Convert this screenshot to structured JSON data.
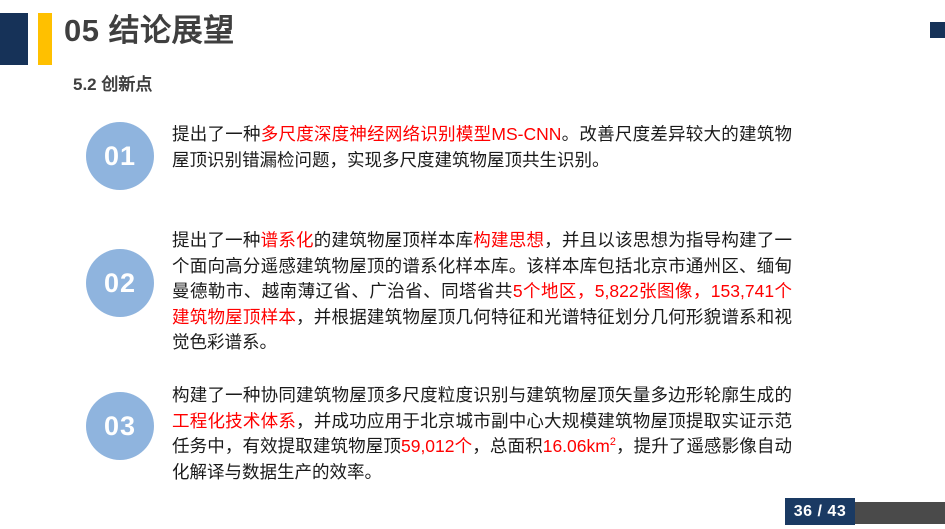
{
  "slide": {
    "title": "05 结论展望",
    "subtitle": "5.2 创新点",
    "accent_navy": "#163258",
    "accent_yellow": "#FFC000",
    "badge_blue": "#8FB4DE",
    "highlight_red": "#FF0000"
  },
  "bullets": [
    {
      "number": "01",
      "segments": [
        {
          "text": "提出了一种",
          "highlight": false
        },
        {
          "text": "多尺度深度神经网络识别模型MS-CNN",
          "highlight": true
        },
        {
          "text": "。改善尺度差异较大的建筑物屋顶识别错漏检问题，实现多尺度建筑物屋顶共生识别。",
          "highlight": false
        }
      ]
    },
    {
      "number": "02",
      "segments": [
        {
          "text": "提出了一种",
          "highlight": false
        },
        {
          "text": "谱系化",
          "highlight": true
        },
        {
          "text": "的建筑物屋顶样本库",
          "highlight": false
        },
        {
          "text": "构建思想",
          "highlight": true
        },
        {
          "text": "，并且以该思想为指导构建了一个面向高分遥感建筑物屋顶的谱系化样本库。该样本库包括北京市通州区、缅甸曼德勒市、越南薄辽省、广治省、同塔省共",
          "highlight": false
        },
        {
          "text": "5个地区，5,822张图像，153,741个建筑物屋顶样本",
          "highlight": true
        },
        {
          "text": "，并根据建筑物屋顶几何特征和光谱特征划分几何形貌谱系和视觉色彩谱系。",
          "highlight": false
        }
      ]
    },
    {
      "number": "03",
      "segments": [
        {
          "text": "构建了一种协同建筑物屋顶多尺度粒度识别与建筑物屋顶矢量多边形轮廓生成的",
          "highlight": false
        },
        {
          "text": "工程化技术体系",
          "highlight": true
        },
        {
          "text": "，并成功应用于北京城市副中心大规模建筑物屋顶提取实证示范任务中，有效提取建筑物屋顶",
          "highlight": false
        },
        {
          "text": "59,012个",
          "highlight": true
        },
        {
          "text": "，总面积",
          "highlight": false
        },
        {
          "text": "16.06km",
          "highlight": true,
          "sup": "2"
        },
        {
          "text": "，提升了遥感影像自动化解译与数据生产的效率。",
          "highlight": false
        }
      ]
    }
  ],
  "footer": {
    "page_label": "36 / 43",
    "current_page": "36",
    "total_pages": "43"
  }
}
